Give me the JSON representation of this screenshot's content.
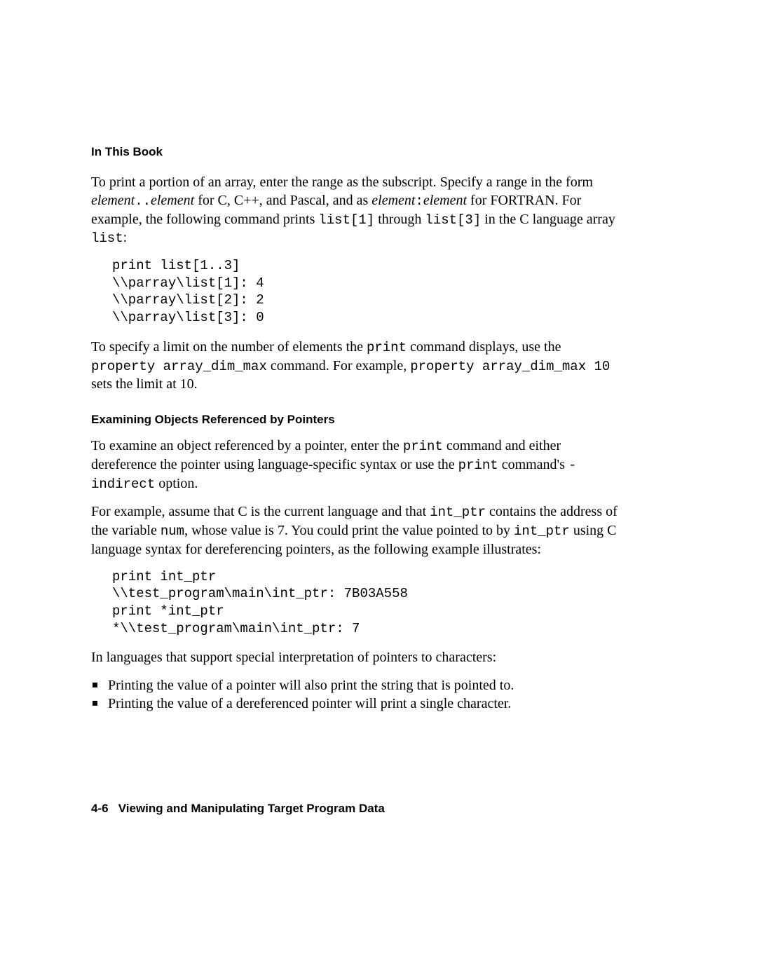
{
  "header": "In This Book",
  "para1a": "To print a portion of an array, enter the range as the subscript. Specify a range in the form ",
  "para1_el1": "element",
  "para1_dd": "..",
  "para1_el2": "element",
  "para1b": " for C, C++, and Pascal, and as ",
  "para1_el3": "element",
  "para1_colon": ":",
  "para1_el4": "element",
  "para1c": " for FORTRAN. For example, the following command prints ",
  "para1_code1": "list[1]",
  "para1d": " through ",
  "para1_code2": "list[3]",
  "para1e": " in the C language array ",
  "para1_code3": "list",
  "para1f": ":",
  "code1": "print list[1..3]\n\\\\parray\\list[1]: 4\n\\\\parray\\list[2]: 2\n\\\\parray\\list[3]: 0",
  "para2a": "To specify a limit on the number of elements the ",
  "para2_code1": "print",
  "para2b": " command displays, use the ",
  "para2_code2": "property array_dim_max",
  "para2c": " command. For example, ",
  "para2_code3": "property array_dim_max 10",
  "para2d": " sets the limit at 10.",
  "subheading": "Examining Objects Referenced by Pointers",
  "para3a": "To examine an object referenced by a pointer, enter the ",
  "para3_code1": "print",
  "para3b": " command and either dereference the pointer using language-specific syntax or use the ",
  "para3_code2": "print",
  "para3c": " command's ",
  "para3_code3": "-indirect",
  "para3d": " option.",
  "para4a": "For example, assume that C is the current language and that ",
  "para4_code1": "int_ptr",
  "para4b": " contains the address of the variable ",
  "para4_code2": "num",
  "para4c": ", whose value is 7. You could print the value pointed to by ",
  "para4_code3": "int_ptr",
  "para4d": " using C language syntax for dereferencing pointers, as the following example illustrates:",
  "code2": "print int_ptr\n\\\\test_program\\main\\int_ptr: 7B03A558\nprint *int_ptr\n*\\\\test_program\\main\\int_ptr: 7",
  "para5": "In languages that support special interpretation of pointers to characters:",
  "bullet1": "Printing the value of a pointer will also print the string that is pointed to.",
  "bullet2": "Printing the value of a dereferenced pointer will print a single character.",
  "footer_page": "4-6",
  "footer_title": "Viewing and Manipulating Target Program Data"
}
